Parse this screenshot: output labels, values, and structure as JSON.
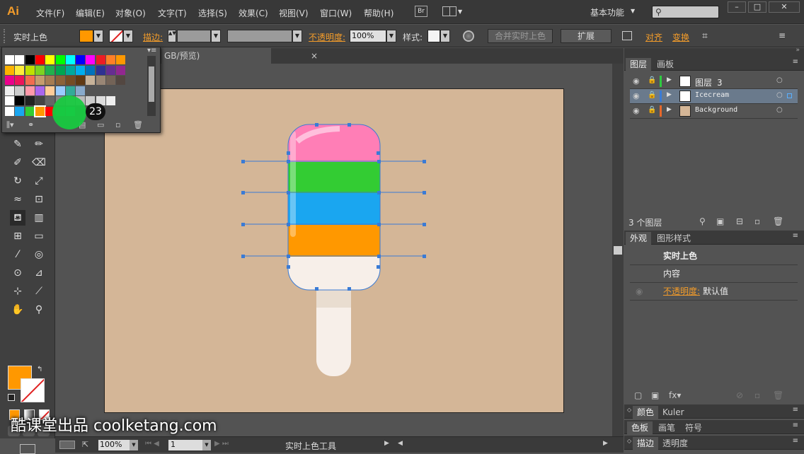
{
  "app": {
    "logo": "Ai"
  },
  "menu": [
    "文件(F)",
    "编辑(E)",
    "对象(O)",
    "文字(T)",
    "选择(S)",
    "效果(C)",
    "视图(V)",
    "窗口(W)",
    "帮助(H)"
  ],
  "header": {
    "br_label": "Br",
    "workspace": "基本功能"
  },
  "control": {
    "tool_name": "实时上色",
    "stroke_label": "描边:",
    "opacity_label": "不透明度:",
    "opacity_value": "100%",
    "style_label": "样式:",
    "merge_button": "合并实时上色",
    "expand_button": "扩展",
    "align_label": "对齐",
    "transform_label": "变换"
  },
  "document": {
    "tab_title": "GB/预览)",
    "close": "×"
  },
  "status": {
    "zoom": "100%",
    "artboard_num": "1",
    "tool_status": "实时上色工具"
  },
  "layers_panel": {
    "tabs": [
      "图层",
      "画板"
    ],
    "layers": [
      {
        "name": "图层 3",
        "color": "#2ecc40"
      },
      {
        "name": "Icecream",
        "color": "#3a7bd5"
      },
      {
        "name": "Background",
        "color": "#e8682a"
      }
    ],
    "count": "3 个图层"
  },
  "appearance_panel": {
    "tabs": [
      "外观",
      "图形样式"
    ],
    "title": "实时上色",
    "contents": "内容",
    "opacity_label": "不透明度:",
    "opacity_value": "默认值"
  },
  "collapsed_panels": {
    "color": [
      "颜色",
      "Kuler"
    ],
    "swatches": [
      "色板",
      "画笔",
      "符号"
    ],
    "stroke": [
      "描边",
      "透明度"
    ]
  },
  "overlay": {
    "step_badge": "23",
    "watermark": "酷课堂出品 coolketang.com"
  },
  "colors": {
    "fill": "#ff9800",
    "artboard": "#d4b697",
    "pink": "#ff7eb6",
    "green": "#33cc33",
    "blue": "#1aa6f0",
    "orange": "#ff9800",
    "cream": "#f7efe9"
  }
}
